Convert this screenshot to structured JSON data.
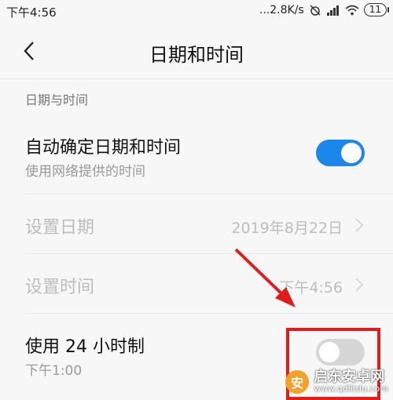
{
  "status_bar": {
    "time": "下午4:56",
    "network_speed": "...2.8K/s",
    "battery": "11"
  },
  "header": {
    "title": "日期和时间"
  },
  "section": {
    "label": "日期与时间"
  },
  "settings": {
    "auto_datetime": {
      "title": "自动确定日期和时间",
      "subtitle": "使用网络提供的时间",
      "enabled": true
    },
    "set_date": {
      "title": "设置日期",
      "value": "2019年8月22日"
    },
    "set_time": {
      "title": "设置时间",
      "value": "下午4:56"
    },
    "use_24h": {
      "title": "使用 24 小时制",
      "subtitle": "下午1:00",
      "enabled": false
    }
  },
  "colors": {
    "accent": "#1b87ea",
    "annotation": "#e21b1b"
  },
  "watermark": {
    "name": "启东安卓网",
    "url": "www.qdlitdu.com"
  }
}
